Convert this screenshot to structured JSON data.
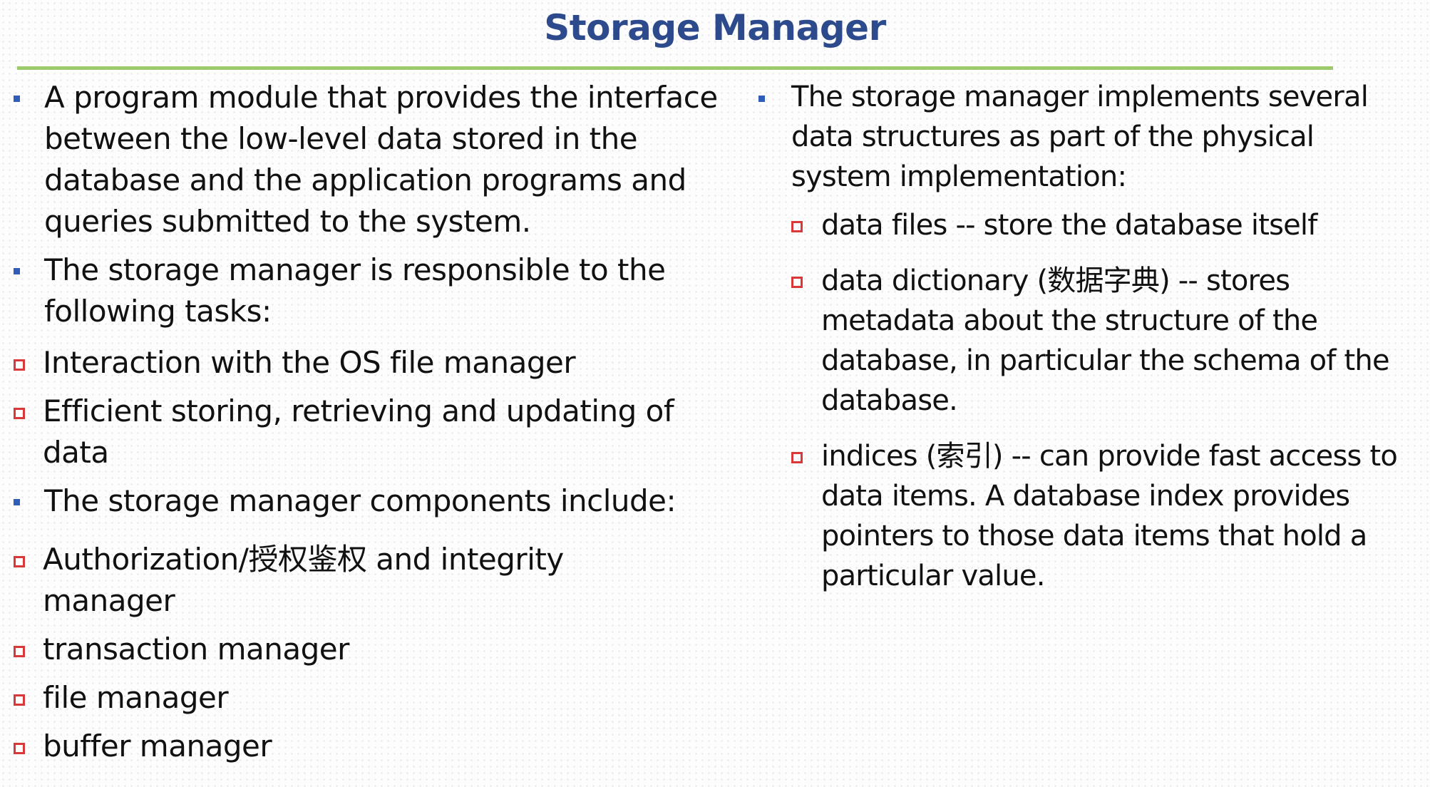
{
  "title": "Storage Manager",
  "left_column": {
    "items": [
      {
        "text": "A program module that provides the interface between the low-level data stored in the database and the application programs and queries submitted to the system."
      },
      {
        "text": "The storage manager is responsible to the following tasks:",
        "subitems": [
          "Interaction with the OS file manager",
          "Efficient storing, retrieving and updating of data"
        ]
      },
      {
        "text": "The storage manager components include:",
        "subitems": [
          "Authorization/授权鉴权 and integrity manager",
          "transaction manager",
          "file manager",
          "buffer manager"
        ]
      }
    ]
  },
  "right_column": {
    "items": [
      {
        "text": "The storage manager implements several data structures as part of the physical system implementation:",
        "subitems": [
          "data files -- store the database itself",
          "data dictionary (数据字典) --  stores metadata about the structure of the database, in particular the schema of the database.",
          "indices (索引) --  can provide fast access to data items.  A database index provides pointers to those data items that hold a particular value."
        ]
      }
    ]
  },
  "colors": {
    "title": "#2c4a8c",
    "rule": "#9cc96a",
    "primary_bullet": "#2f5db7",
    "secondary_bullet": "#d9383a",
    "text": "#111111"
  },
  "icons": {
    "primary_bullet": "filled-square-bullet-icon",
    "secondary_bullet": "hollow-square-bullet-icon"
  }
}
